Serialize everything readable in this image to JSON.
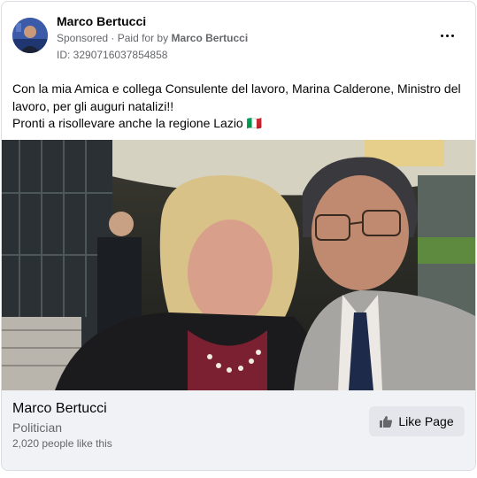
{
  "ad": {
    "advertiser_name": "Marco Bertucci",
    "sponsored_label": "Sponsored",
    "paid_for_prefix": "Paid for by",
    "paid_for_name": "Marco Bertucci",
    "ad_id": "ID: 3290716037854858",
    "more_icon": "more-horizontal-icon"
  },
  "post": {
    "line1": "Con la mia Amica e collega Consulente del lavoro, Marina Calderone, Ministro del lavoro, per gli auguri natalizi!!",
    "line2": "Pronti a risollevare anche la regione Lazio 🇮🇹"
  },
  "page": {
    "name": "Marco Bertucci",
    "category": "Politician",
    "likes": "2,020 people like this",
    "like_button": "Like Page",
    "like_icon": "thumbs-up-icon"
  }
}
